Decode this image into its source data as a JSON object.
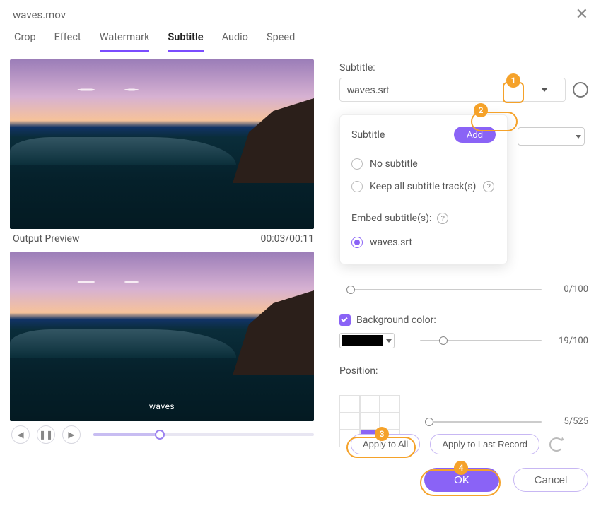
{
  "header": {
    "filename": "waves.mov"
  },
  "tabs": {
    "crop": "Crop",
    "effect": "Effect",
    "watermark": "Watermark",
    "subtitle": "Subtitle",
    "audio": "Audio",
    "speed": "Speed"
  },
  "preview": {
    "output_label": "Output Preview",
    "time": "00:03/00:11",
    "embedded_text": "waves"
  },
  "subtitle_panel": {
    "label": "Subtitle:",
    "input_value": "waves.srt",
    "popup": {
      "title": "Subtitle",
      "add_label": "Add",
      "no_subtitle": "No subtitle",
      "keep_all": "Keep all subtitle track(s)",
      "embed_label": "Embed subtitle(s):",
      "selected_file": "waves.srt"
    },
    "transparency_value": "0/100",
    "bg_color_label": "Background color:",
    "bg_value": "19/100",
    "position_label": "Position:",
    "position_value": "5/525"
  },
  "actions": {
    "apply_all": "Apply to All",
    "apply_last": "Apply to Last Record",
    "ok": "OK",
    "cancel": "Cancel"
  },
  "annotations": {
    "n1": "1",
    "n2": "2",
    "n3": "3",
    "n4": "4"
  }
}
